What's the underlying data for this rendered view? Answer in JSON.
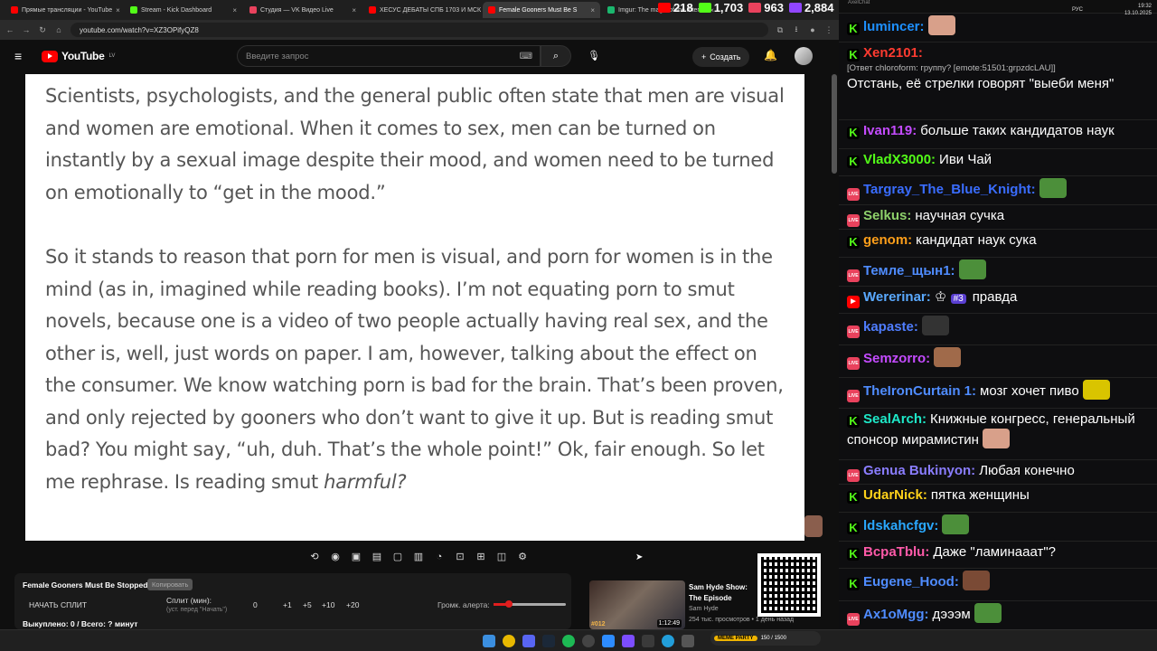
{
  "browser": {
    "tabs": [
      {
        "label": "Прямые трансляции - YouTube",
        "color": "#ff0000"
      },
      {
        "label": "Stream - Kick Dashboard",
        "color": "#53fc18"
      },
      {
        "label": "Студия — VK Видео Live",
        "color": "#e9425d"
      },
      {
        "label": "ХЕСУС ДЕБАТЫ СПБ 1703 И МСК",
        "color": "#ff0000"
      },
      {
        "label": "Female Gooners Must Be S",
        "color": "#ff0000",
        "active": true
      },
      {
        "label": "Imgur: The magic of the Intern",
        "color": "#1bb76e"
      }
    ],
    "url": "youtube.com/watch?v=XZ3OPifyQZ8"
  },
  "youtube": {
    "logo_text": "YouTube",
    "region": "LV",
    "search_placeholder": "Введите запрос",
    "create_label": "Создать"
  },
  "video_text": {
    "para1": "Scientists, psychologists, and the general public often state that men are visual and women are emotional. When it comes to sex, men can be turned on instantly by a sexual image despite their mood, and women need to be turned on emotionally to “get in the mood.”",
    "para2_main": "So it stands to reason that porn for men is visual, and porn for women is in the mind (as in, imagined while reading books). I’m not equating porn to smut novels, because one is a video of two people actually having real sex, and the other is, well, just words on paper. I am, however, talking about the effect on the consumer. We know watching porn is bad for the brain. That’s been proven, and only rejected by gooners who don’t want to give it up. But is reading smut bad? You might say, “uh, duh. That’s the whole point!” Ok, fair enough. So let me rephrase. Is reading smut ",
    "para2_em": "harmful?"
  },
  "split_panel": {
    "title": "Female Gooners Must Be Stopped",
    "copy_label": "Копировать",
    "start_label": "НАЧАТЬ СПЛИТ",
    "split_label": "Сплит (мин):",
    "split_hint": "(уст. перед \"Начать\")",
    "split_value": "0",
    "increments": [
      "+1",
      "+5",
      "+10",
      "+20"
    ],
    "volume_label": "Громк. алерта:",
    "volume_fraction": 0.19,
    "stats": "Выкуплено: 0 / Всего: ? минут"
  },
  "recommended": {
    "title": "Sam Hyde Show: The Episode",
    "channel": "Sam Hyde",
    "views": "254 тыс. просмотров • 1 день назад",
    "duration": "1:12:49",
    "episode": "#012"
  },
  "counters": [
    {
      "icon": "youtube-icon",
      "value": "218",
      "color": "#ff0000"
    },
    {
      "icon": "kick-icon",
      "value": "1,703",
      "color": "#53fc18"
    },
    {
      "icon": "vk-live-icon",
      "value": "963",
      "color": "#e9425d"
    },
    {
      "icon": "twitch-icon",
      "value": "2,884",
      "color": "#9146ff"
    }
  ],
  "chat_header": "AxelChat",
  "chat": [
    {
      "platform": "kick",
      "nick": "lumincer:",
      "color": "#1e90ff",
      "text": "",
      "emote": "#d8a08a"
    },
    {
      "platform": "kick",
      "nick": "Xen2101:",
      "color": "#ff3b30",
      "reply": "[Ответ chloroform: группу? [emote:51501:grpzdcLAU]]",
      "text": "Отстань, её стрелки говорят \"выеби меня\""
    },
    {
      "platform": "kick",
      "nick": "Ivan119:",
      "color": "#c44bff",
      "text": "больше таких кандидатов наук"
    },
    {
      "platform": "kick",
      "nick": "VladX3000:",
      "color": "#53fc18",
      "text": "Иви Чай"
    },
    {
      "platform": "vk",
      "nick": "Targray_The_Blue_Knight:",
      "color": "#3a6dff",
      "text": "",
      "emote": "#4c8f3a"
    },
    {
      "platform": "vk",
      "nick": "Selkus:",
      "color": "#8ed16b",
      "text": "научная сучка"
    },
    {
      "platform": "kick",
      "nick": "genom:",
      "color": "#ff9f1a",
      "text": "кандидат наук сука"
    },
    {
      "platform": "vk",
      "nick": "Темле_щын1:",
      "color": "#4f8cff",
      "text": "",
      "emote": "#4c8f3a"
    },
    {
      "platform": "youtube",
      "nick": "Wererinar:",
      "color": "#5aa9ff",
      "text": "правда",
      "badge": "#3"
    },
    {
      "platform": "vk",
      "nick": "kapaste:",
      "color": "#4f7dff",
      "text": "",
      "emote": "#333333"
    },
    {
      "platform": "vk",
      "nick": "Semzorro:",
      "color": "#c44bff",
      "text": "",
      "emote": "#a06a4a"
    },
    {
      "platform": "vk",
      "nick": "TheIronCurtain 1:",
      "color": "#4f8cff",
      "text": "мозг хочет пиво",
      "emote": "#d9c400"
    },
    {
      "platform": "kick",
      "nick": "SealArch:",
      "color": "#1ee8c8",
      "text": "Книжные конгресс, генеральный спонсор мирамистин",
      "emote": "#d8a08a"
    },
    {
      "platform": "vk",
      "nick": "Genua Bukinyon:",
      "color": "#8a7dff",
      "text": "Любая конечно"
    },
    {
      "platform": "kick",
      "nick": "UdarNick:",
      "color": "#ffd21a",
      "text": "пятка женщины"
    },
    {
      "platform": "kick",
      "nick": "ldskahcfgv:",
      "color": "#2aa8ff",
      "text": "",
      "emote": "#4c8f3a"
    },
    {
      "platform": "kick",
      "nick": "BcpaTblu:",
      "color": "#ff5aa8",
      "text": "Даже \"ламинааат\"?"
    },
    {
      "platform": "kick",
      "nick": "Eugene_Hood:",
      "color": "#4f8cff",
      "text": "",
      "emote": "#7a4a35"
    },
    {
      "platform": "vk",
      "nick": "Ax1oMgg:",
      "color": "#4f8cff",
      "text": "дэээм",
      "emote": "#4c8f3a"
    }
  ],
  "taskbar": {
    "time": "19:32",
    "date": "13.10.2025",
    "lang": "РУС",
    "kick_pill": "MEME PARTY",
    "kick_count": "150 / 1500"
  }
}
